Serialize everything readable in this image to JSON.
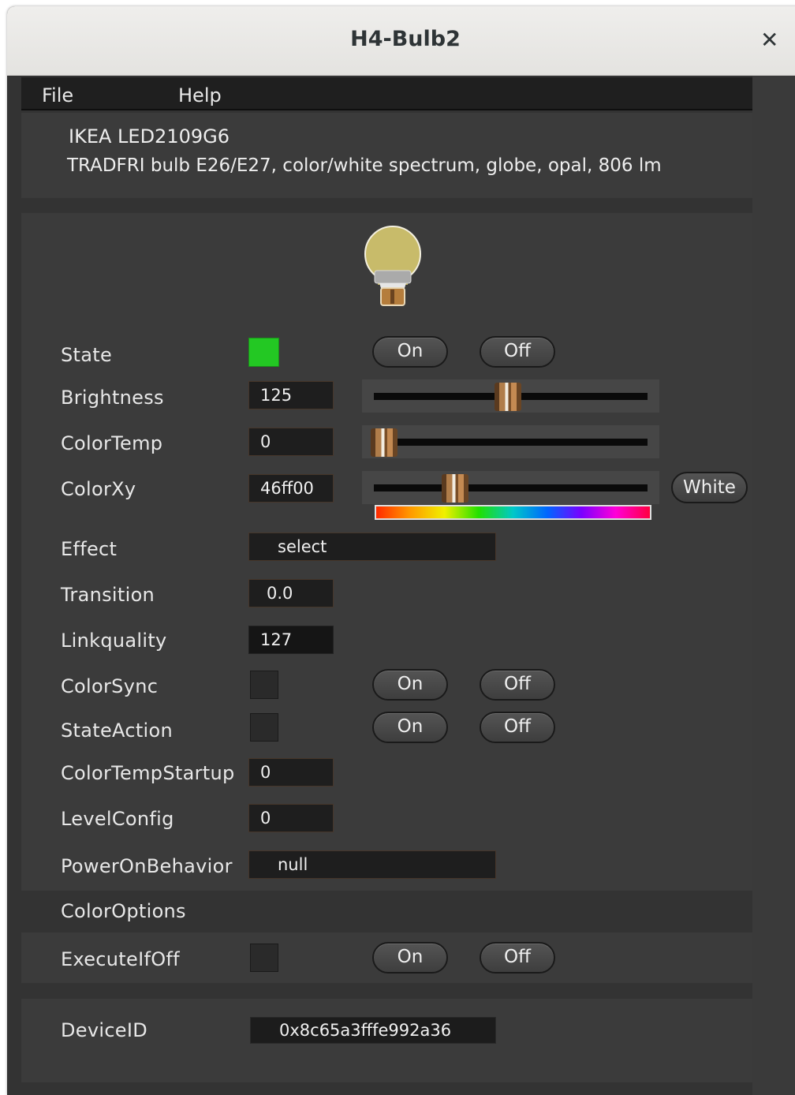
{
  "window": {
    "title": "H4-Bulb2",
    "close_glyph": "✕"
  },
  "menu": {
    "file": "File",
    "help": "Help"
  },
  "device": {
    "model": "IKEA LED2109G6",
    "description": "TRADFRI bulb E26/E27, color/white spectrum, globe, opal, 806 lm"
  },
  "colors": {
    "state_on": "#23c823",
    "bulb_glass": "#c8bb6a"
  },
  "controls": {
    "state": {
      "label": "State",
      "on": "On",
      "off": "Off",
      "checked": true
    },
    "brightness": {
      "label": "Brightness",
      "value": "125",
      "slider": 0.49
    },
    "colortemp": {
      "label": "ColorTemp",
      "value": "0",
      "slider": 0.0
    },
    "colorxy": {
      "label": "ColorXy",
      "value": "46ff00",
      "slider": 0.28,
      "white_button": "White"
    },
    "effect": {
      "label": "Effect",
      "value": "select"
    },
    "transition": {
      "label": "Transition",
      "value": "0.0"
    },
    "linkquality": {
      "label": "Linkquality",
      "value": "127"
    },
    "colorsync": {
      "label": "ColorSync",
      "on": "On",
      "off": "Off",
      "checked": false
    },
    "stateaction": {
      "label": "StateAction",
      "on": "On",
      "off": "Off",
      "checked": false
    },
    "colortempstartup": {
      "label": "ColorTempStartup",
      "value": "0"
    },
    "levelconfig": {
      "label": "LevelConfig",
      "value": "0"
    },
    "poweronbehavior": {
      "label": "PowerOnBehavior",
      "value": "null"
    }
  },
  "coloroptions": {
    "label": "ColorOptions",
    "executeifoff": {
      "label": "ExecuteIfOff",
      "on": "On",
      "off": "Off",
      "checked": false
    }
  },
  "footer": {
    "deviceid_label": "DeviceID",
    "deviceid": "0x8c65a3fffe992a36"
  }
}
